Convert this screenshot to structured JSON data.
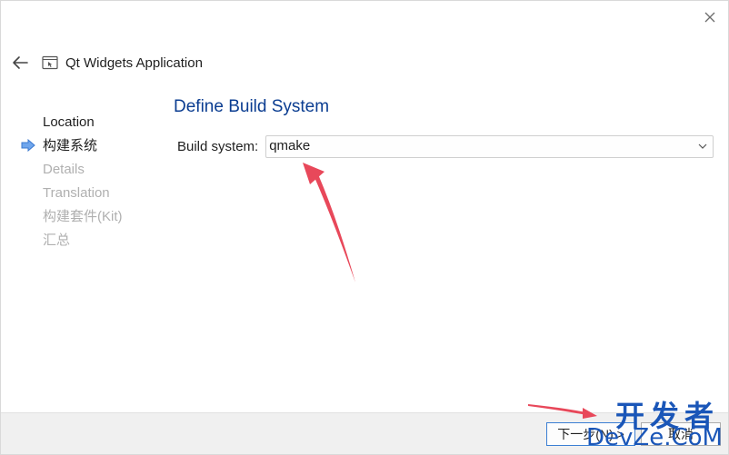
{
  "window": {
    "title": "Qt Widgets Application",
    "close_icon": "close-icon",
    "back_icon": "arrow-left-icon",
    "app_icon": "window-icon"
  },
  "steps": [
    {
      "label": "Location",
      "state": "done"
    },
    {
      "label": "构建系统",
      "state": "current"
    },
    {
      "label": "Details",
      "state": "pending"
    },
    {
      "label": "Translation",
      "state": "pending"
    },
    {
      "label": "构建套件(Kit)",
      "state": "pending"
    },
    {
      "label": "汇总",
      "state": "pending"
    }
  ],
  "page": {
    "title": "Define Build System",
    "build_system_label": "Build system:",
    "build_system_value": "qmake"
  },
  "buttons": {
    "next": "下一步(N) >",
    "cancel": "取消"
  },
  "watermark": {
    "line1": "开发者",
    "line2": "DevZe.CoM"
  },
  "colors": {
    "accent": "#0b3d91",
    "annotation": "#e8485a",
    "current_arrow": "#4a8be0"
  }
}
